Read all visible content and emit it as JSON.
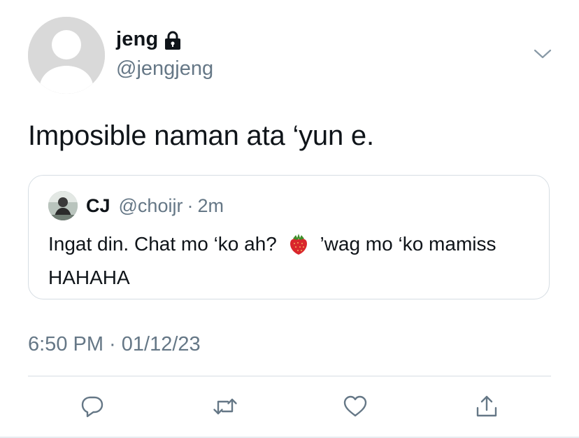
{
  "author": {
    "display_name": "jeng",
    "handle": "@jengjeng",
    "protected_icon": "lock-icon"
  },
  "tweet": {
    "text": "Imposible naman ata ‘yun e.",
    "timestamp": "6:50 PM · 01/12/23"
  },
  "quoted_tweet": {
    "display_name": "CJ",
    "handle": "@choijr",
    "separator": "·",
    "time": "2m",
    "text_before_emoji": "Ingat din. Chat mo ‘ko ah?",
    "emoji": "strawberry-emoji",
    "text_after_emoji": "’wag mo ‘ko mamiss HAHAHA"
  },
  "actions": [
    {
      "name": "reply",
      "icon": "comment-icon"
    },
    {
      "name": "retweet",
      "icon": "retweet-icon"
    },
    {
      "name": "like",
      "icon": "heart-icon"
    },
    {
      "name": "share",
      "icon": "share-icon"
    }
  ],
  "colors": {
    "text_primary": "#0f1419",
    "text_secondary": "#657786",
    "border": "#d6dde3",
    "avatar_placeholder": "#d9d9d9"
  }
}
